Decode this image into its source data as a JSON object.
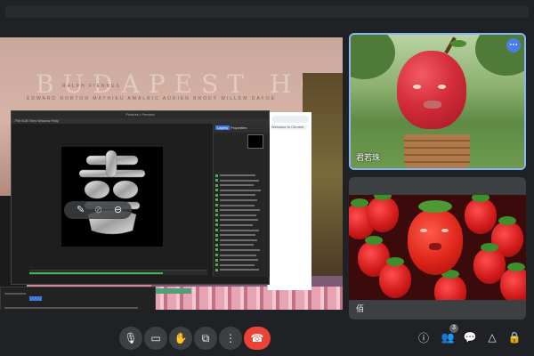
{
  "shared_screen": {
    "poster_title": "BUDAPEST HOTEL",
    "poster_credits_top": "RALPH FIENNES",
    "poster_credits_bottom": "EDWARD NORTON  MATHIEU AMALRIC  ADRIEN BRODY  WILLEM DAFOE",
    "app_window_title": "Pictures • Preview",
    "app_menu": "File  Edit  View  Window  Help",
    "panel_tab_active": "Layers",
    "panel_tab_other": "Properties",
    "browser_tab": "Welcome to Chrome"
  },
  "participants": [
    {
      "name": "君若珠",
      "highlighted": true,
      "avatar": "apple-filter"
    },
    {
      "name": "佰",
      "highlighted": false,
      "avatar": "strawberry-filter"
    }
  ],
  "participant_count": "3",
  "controls": {
    "mic": "mic-icon",
    "camera": "camera-icon",
    "raise_hand": "hand-icon",
    "present": "present-icon",
    "more": "more-vert-icon",
    "end_call": "end-call-icon"
  },
  "right_controls": [
    "info-icon",
    "people-icon",
    "chat-icon",
    "activities-icon",
    "lock-icon"
  ],
  "colors": {
    "end_call": "#ea4335",
    "active_border": "#8ab4f8",
    "background": "#202124"
  }
}
